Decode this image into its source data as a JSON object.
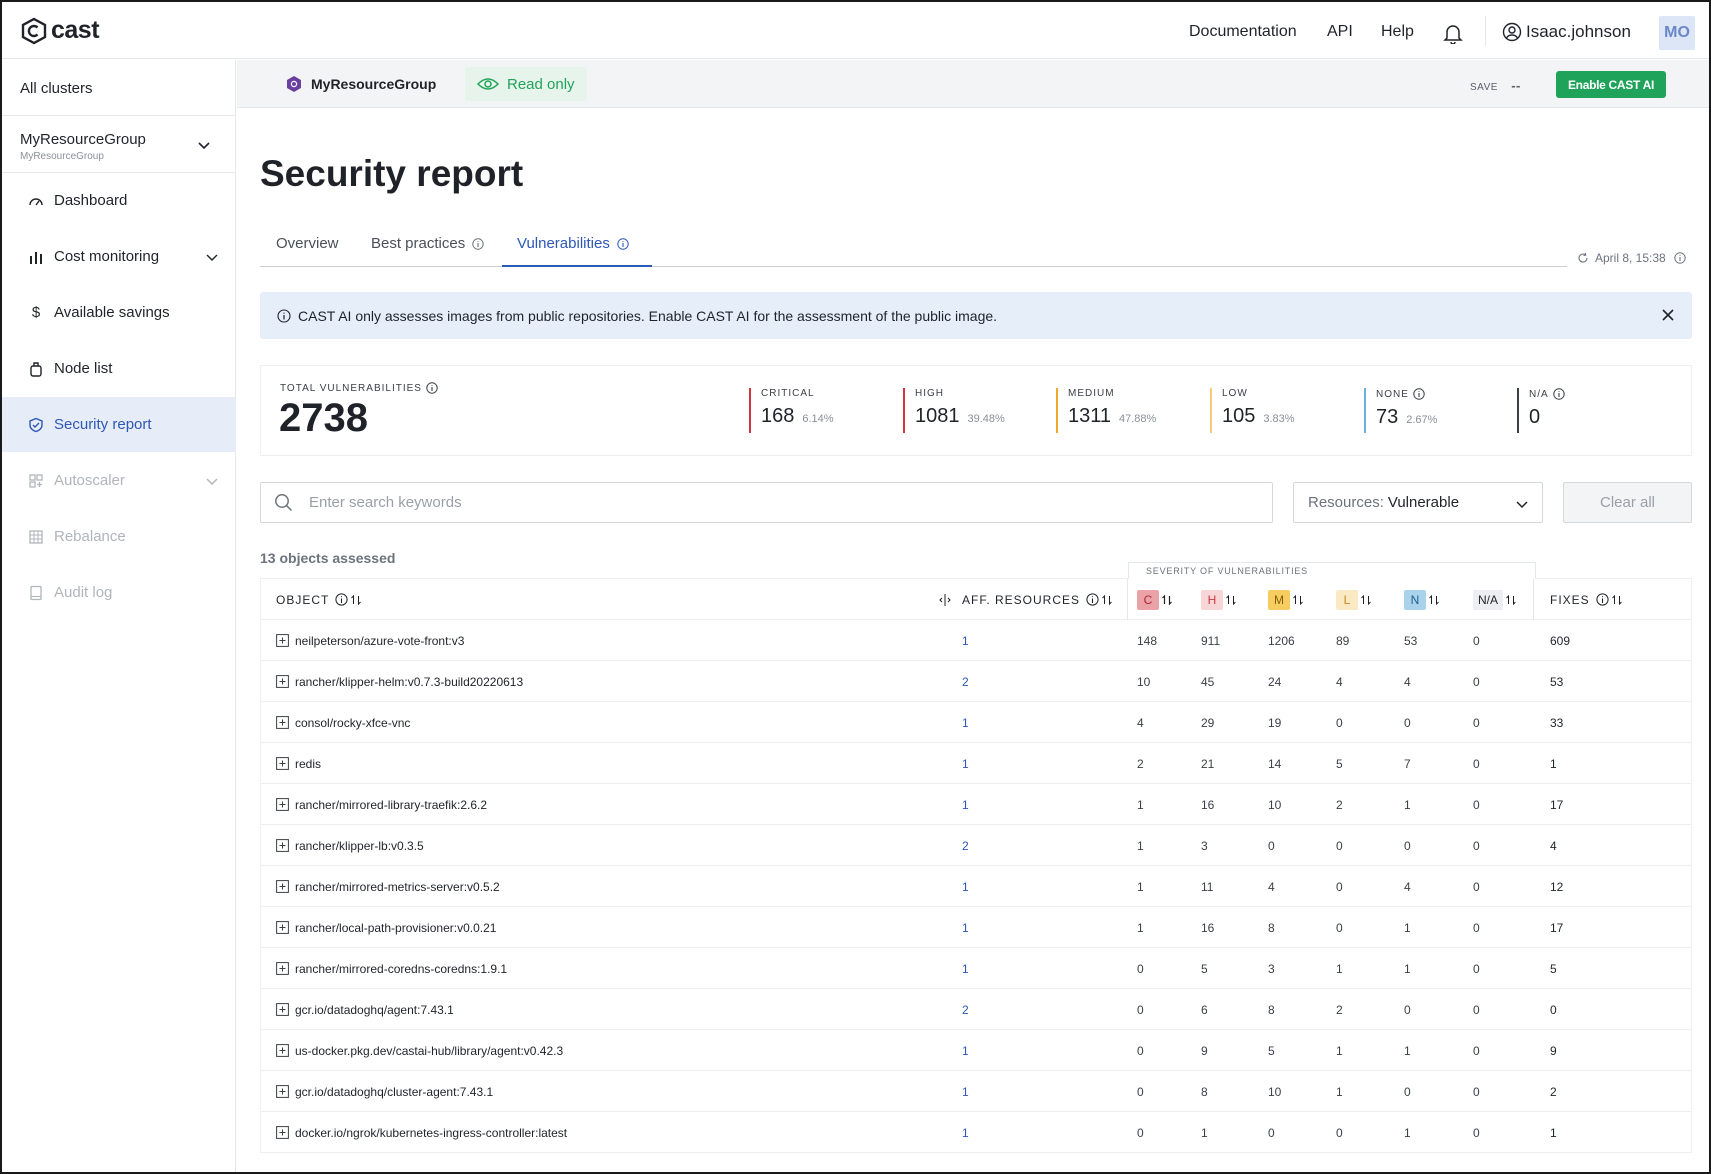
{
  "app": {
    "brand": "cast"
  },
  "topbar": {
    "links": [
      "Documentation",
      "API",
      "Help"
    ],
    "user": "Isaac.johnson",
    "avatar": "MO"
  },
  "sidebar": {
    "all_clusters": "All clusters",
    "cluster": {
      "name": "MyResourceGroup",
      "subtitle": "MyResourceGroup"
    },
    "items": [
      {
        "label": "Dashboard",
        "icon": "gauge-icon",
        "state": "normal"
      },
      {
        "label": "Cost monitoring",
        "icon": "bar-chart-icon",
        "state": "normal",
        "expandable": true
      },
      {
        "label": "Available savings",
        "icon": "dollar-icon",
        "state": "normal"
      },
      {
        "label": "Node list",
        "icon": "node-icon",
        "state": "normal"
      },
      {
        "label": "Security report",
        "icon": "shield-icon",
        "state": "active"
      },
      {
        "label": "Autoscaler",
        "icon": "autoscaler-icon",
        "state": "disabled",
        "expandable": true
      },
      {
        "label": "Rebalance",
        "icon": "grid-icon",
        "state": "disabled"
      },
      {
        "label": "Audit log",
        "icon": "log-icon",
        "state": "disabled"
      }
    ]
  },
  "subheader": {
    "resource_group": "MyResourceGroup",
    "read_only": "Read only",
    "save_label": "SAVE",
    "save_value": "--",
    "enable_button": "Enable CAST AI"
  },
  "page": {
    "title": "Security report",
    "tabs": [
      "Overview",
      "Best practices",
      "Vulnerabilities"
    ],
    "active_tab": "Vulnerabilities",
    "updated": "April 8, 15:38"
  },
  "banner": {
    "text": "CAST AI only assesses images from public repositories. Enable CAST AI for the assessment of the public image."
  },
  "stats": {
    "total_label": "TOTAL VULNERABILITIES",
    "total": "2738",
    "severities": [
      {
        "label": "CRITICAL",
        "value": "168",
        "pct": "6.14%",
        "color": "#d0343f"
      },
      {
        "label": "HIGH",
        "value": "1081",
        "pct": "39.48%",
        "color": "#d0343f"
      },
      {
        "label": "MEDIUM",
        "value": "1311",
        "pct": "47.88%",
        "color": "#f0a92e"
      },
      {
        "label": "LOW",
        "value": "105",
        "pct": "3.83%",
        "color": "#f5c97a"
      },
      {
        "label": "NONE",
        "value": "73",
        "pct": "2.67%",
        "color": "#6ab0de",
        "info": true
      },
      {
        "label": "N/A",
        "value": "0",
        "pct": "",
        "color": "#3a3f46",
        "info": true
      }
    ]
  },
  "filters": {
    "search_placeholder": "Enter search keywords",
    "resources_prefix": "Resources:",
    "resources_value": "Vulnerable",
    "clear_all": "Clear all"
  },
  "table": {
    "assessed": "13 objects assessed",
    "severity_group_label": "SEVERITY OF VULNERABILITIES",
    "headers": {
      "object": "OBJECT",
      "aff_resources": "AFF. RESOURCES",
      "c": "C",
      "h": "H",
      "m": "M",
      "l": "L",
      "n": "N",
      "na": "N/A",
      "fixes": "FIXES"
    },
    "badge_colors": {
      "c": {
        "bg": "#e9a3a8",
        "fg": "#b3262f"
      },
      "h": {
        "bg": "#f8d6d8",
        "fg": "#d0343f"
      },
      "m": {
        "bg": "#f6cd61",
        "fg": "#8a5b00"
      },
      "l": {
        "bg": "#fbe9c4",
        "fg": "#c58a16"
      },
      "n": {
        "bg": "#a9d3ec",
        "fg": "#1f5f8e"
      }
    },
    "rows": [
      {
        "object": "neilpeterson/azure-vote-front:v3",
        "aff": "1",
        "c": "148",
        "h": "911",
        "m": "1206",
        "l": "89",
        "n": "53",
        "na": "0",
        "fixes": "609"
      },
      {
        "object": "rancher/klipper-helm:v0.7.3-build20220613",
        "aff": "2",
        "c": "10",
        "h": "45",
        "m": "24",
        "l": "4",
        "n": "4",
        "na": "0",
        "fixes": "53"
      },
      {
        "object": "consol/rocky-xfce-vnc",
        "aff": "1",
        "c": "4",
        "h": "29",
        "m": "19",
        "l": "0",
        "n": "0",
        "na": "0",
        "fixes": "33"
      },
      {
        "object": "redis",
        "aff": "1",
        "c": "2",
        "h": "21",
        "m": "14",
        "l": "5",
        "n": "7",
        "na": "0",
        "fixes": "1"
      },
      {
        "object": "rancher/mirrored-library-traefik:2.6.2",
        "aff": "1",
        "c": "1",
        "h": "16",
        "m": "10",
        "l": "2",
        "n": "1",
        "na": "0",
        "fixes": "17"
      },
      {
        "object": "rancher/klipper-lb:v0.3.5",
        "aff": "2",
        "c": "1",
        "h": "3",
        "m": "0",
        "l": "0",
        "n": "0",
        "na": "0",
        "fixes": "4"
      },
      {
        "object": "rancher/mirrored-metrics-server:v0.5.2",
        "aff": "1",
        "c": "1",
        "h": "11",
        "m": "4",
        "l": "0",
        "n": "4",
        "na": "0",
        "fixes": "12"
      },
      {
        "object": "rancher/local-path-provisioner:v0.0.21",
        "aff": "1",
        "c": "1",
        "h": "16",
        "m": "8",
        "l": "0",
        "n": "1",
        "na": "0",
        "fixes": "17"
      },
      {
        "object": "rancher/mirrored-coredns-coredns:1.9.1",
        "aff": "1",
        "c": "0",
        "h": "5",
        "m": "3",
        "l": "1",
        "n": "1",
        "na": "0",
        "fixes": "5"
      },
      {
        "object": "gcr.io/datadoghq/agent:7.43.1",
        "aff": "2",
        "c": "0",
        "h": "6",
        "m": "8",
        "l": "2",
        "n": "0",
        "na": "0",
        "fixes": "0"
      },
      {
        "object": "us-docker.pkg.dev/castai-hub/library/agent:v0.42.3",
        "aff": "1",
        "c": "0",
        "h": "9",
        "m": "5",
        "l": "1",
        "n": "1",
        "na": "0",
        "fixes": "9"
      },
      {
        "object": "gcr.io/datadoghq/cluster-agent:7.43.1",
        "aff": "1",
        "c": "0",
        "h": "8",
        "m": "10",
        "l": "1",
        "n": "0",
        "na": "0",
        "fixes": "2"
      },
      {
        "object": "docker.io/ngrok/kubernetes-ingress-controller:latest",
        "aff": "1",
        "c": "0",
        "h": "1",
        "m": "0",
        "l": "0",
        "n": "1",
        "na": "0",
        "fixes": "1"
      }
    ]
  }
}
